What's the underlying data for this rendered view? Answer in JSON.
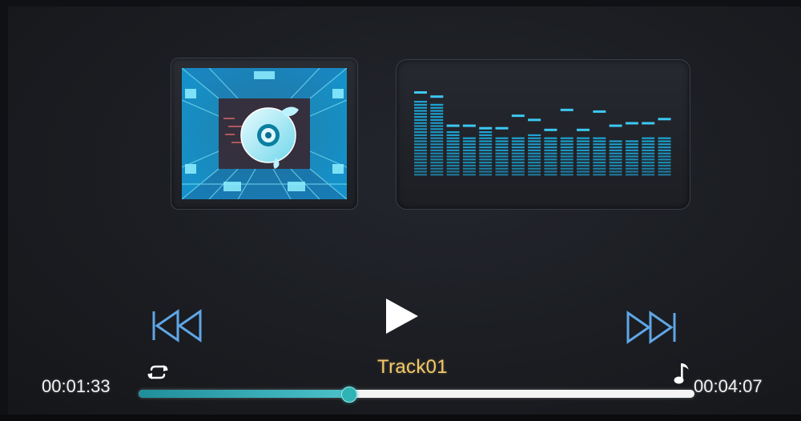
{
  "track": {
    "title": "Track01"
  },
  "time": {
    "elapsed": "00:01:33",
    "total": "00:04:07"
  },
  "progress": {
    "fraction": 0.377
  },
  "colors": {
    "accent": "#4cc2c9",
    "title": "#f3c86b",
    "eq": "#1ea7d8"
  },
  "icons": {
    "prev": "skip-previous-icon",
    "play": "play-icon",
    "next": "skip-next-icon",
    "repeat": "repeat-icon",
    "music": "music-note-icon",
    "album_art": "cd-disc-art"
  },
  "equalizer": {
    "levels": [
      0.92,
      0.9,
      0.55,
      0.5,
      0.55,
      0.5,
      0.5,
      0.52,
      0.5,
      0.48,
      0.48,
      0.5,
      0.46,
      0.47,
      0.48,
      0.5
    ],
    "peaks": [
      1.0,
      0.95,
      0.6,
      0.6,
      0.57,
      0.57,
      0.72,
      0.67,
      0.55,
      0.79,
      0.55,
      0.77,
      0.6,
      0.63,
      0.63,
      0.68
    ]
  }
}
